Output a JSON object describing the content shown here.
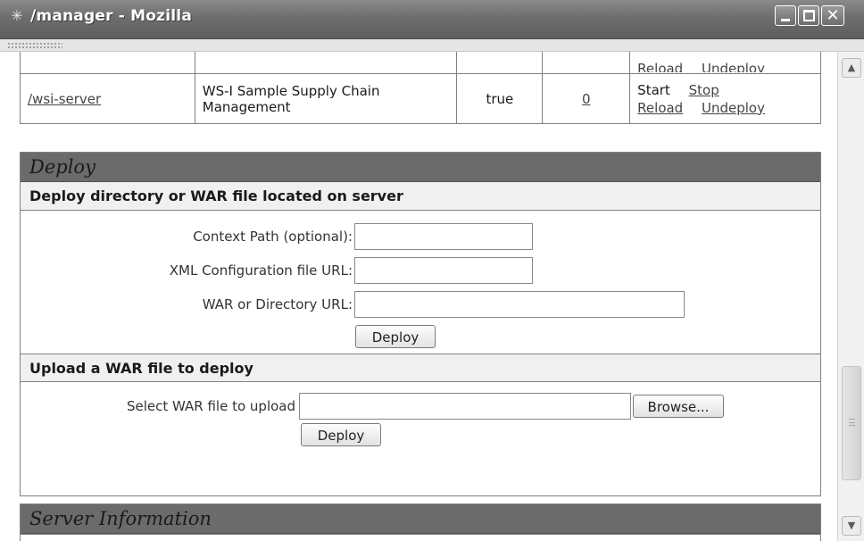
{
  "window": {
    "title": "/manager - Mozilla",
    "app_icon": "mozilla-icon",
    "controls": [
      "minimize",
      "maximize",
      "close"
    ]
  },
  "apps_table": {
    "rows": [
      {
        "path": "",
        "display_name": "",
        "running": "",
        "sessions": "",
        "commands": [
          "Reload",
          "Undeploy"
        ]
      },
      {
        "path": "/wsi-server",
        "display_name": "WS-I Sample Supply Chain Management",
        "running": "true",
        "sessions": "0",
        "commands_line1": [
          "Start",
          "Stop"
        ],
        "commands_line2": [
          "Reload",
          "Undeploy"
        ]
      }
    ]
  },
  "deploy": {
    "title": "Deploy",
    "server_section": {
      "heading": "Deploy directory or WAR file located on server",
      "context_path_label": "Context Path (optional):",
      "context_path_value": "",
      "xml_config_label": "XML Configuration file URL:",
      "xml_config_value": "",
      "war_dir_label": "WAR or Directory URL:",
      "war_dir_value": "",
      "deploy_button": "Deploy"
    },
    "upload_section": {
      "heading": "Upload a WAR file to deploy",
      "select_label": "Select WAR file to upload",
      "file_value": "",
      "browse_button": "Browse...",
      "deploy_button": "Deploy"
    }
  },
  "server_info": {
    "title": "Server Information"
  },
  "scrollbar": {
    "position": 0.72
  }
}
